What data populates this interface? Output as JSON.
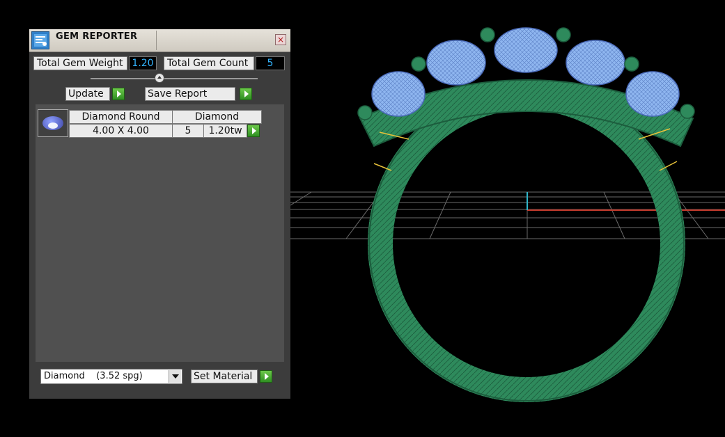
{
  "panel": {
    "title": "GEM REPORTER",
    "close_glyph": "×",
    "total_weight_label": "Total Gem Weight",
    "total_weight_value": "1.20",
    "total_count_label": "Total Gem Count",
    "total_count_value": "5",
    "update_label": "Update",
    "save_report_label": "Save Report"
  },
  "gem_list": {
    "rows": [
      {
        "name": "Diamond Round",
        "type": "Diamond",
        "size": "4.00 X 4.00",
        "count": "5",
        "weight": "1.20tw"
      }
    ]
  },
  "material": {
    "selected": "Diamond    (3.52 spg)",
    "set_label": "Set Material"
  },
  "icons": [
    "gem-reporter-app-icon",
    "close-icon",
    "slider-knob",
    "play-arrow-icon",
    "dropdown-arrow-icon",
    "gem-thumbnail-icon"
  ],
  "colors": {
    "value_text": "#32b4ff",
    "ring_metal": "#2e8a5c",
    "gem_wire": "#8fb6f0",
    "axis_x": "#c0392b",
    "axis_z": "#2fb5c8"
  }
}
